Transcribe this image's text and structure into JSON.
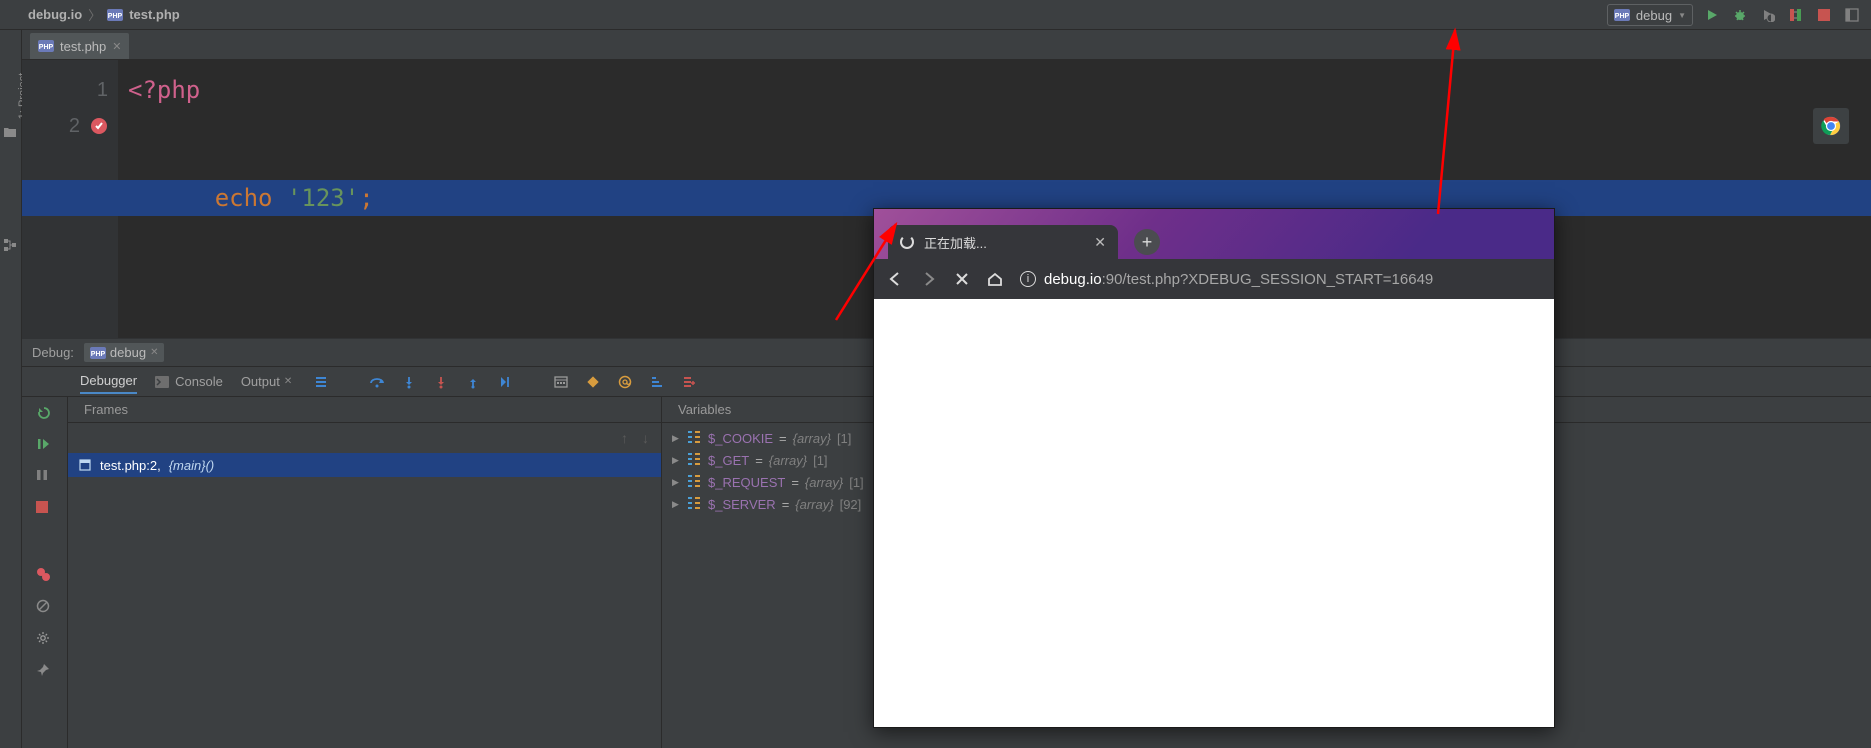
{
  "breadcrumbs": {
    "project": "debug.io",
    "file": "test.php"
  },
  "run_config": {
    "label": "debug"
  },
  "editor_tab": {
    "label": "test.php"
  },
  "code": {
    "l1_num": "1",
    "l2_num": "2",
    "l1": "<?php",
    "l2_echo": "echo",
    "l2_str": "'123'",
    "l2_punc": ";"
  },
  "side_tabs": {
    "project": "1: Project",
    "structure": "7: Structure"
  },
  "debug": {
    "label": "Debug:",
    "config_name": "debug",
    "tabs": {
      "debugger": "Debugger",
      "console": "Console",
      "output": "Output"
    },
    "frames": {
      "title": "Frames",
      "item_loc": "test.php:2,",
      "item_fn": "{main}()"
    },
    "variables": {
      "title": "Variables",
      "rows": [
        {
          "name": "$_COOKIE",
          "type": "{array}",
          "size": "[1]"
        },
        {
          "name": "$_GET",
          "type": "{array}",
          "size": "[1]"
        },
        {
          "name": "$_REQUEST",
          "type": "{array}",
          "size": "[1]"
        },
        {
          "name": "$_SERVER",
          "type": "{array}",
          "size": "[92]"
        }
      ]
    }
  },
  "browser": {
    "tab_title": "正在加载...",
    "url_host": "debug.io",
    "url_rest": ":90/test.php?XDEBUG_SESSION_START=16649"
  }
}
